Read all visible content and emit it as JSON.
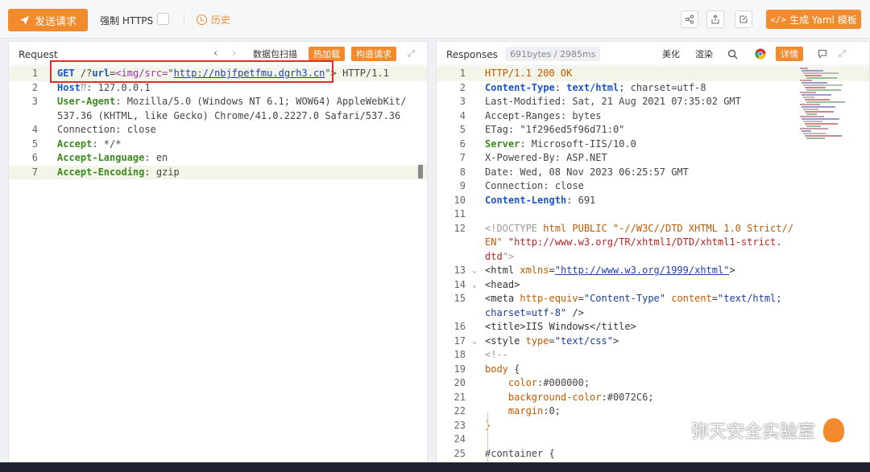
{
  "toolbar": {
    "send_label": "发送请求",
    "https_label": "强制 HTTPS",
    "history_label": "历史",
    "yaml_label": "生成 Yaml 模板",
    "icons": [
      "share-icon",
      "export-icon",
      "edit-icon"
    ]
  },
  "request": {
    "title": "Request",
    "buttons": [
      "数据包扫描",
      "热加载",
      "构造请求"
    ],
    "lines": [
      {
        "n": "1",
        "parts": [
          {
            "t": "GET",
            "c": "kw"
          },
          {
            "t": " /?",
            "c": "val"
          },
          {
            "t": "url",
            "c": "kw"
          },
          {
            "t": "=",
            "c": "val"
          },
          {
            "t": "<img/src=",
            "c": "purple"
          },
          {
            "t": "\"",
            "c": "val"
          },
          {
            "t": "http://nbjfpetfmu.dgrh3.cn",
            "c": "link"
          },
          {
            "t": "\">",
            "c": "val"
          },
          {
            "t": " HTTP/1.1",
            "c": "val"
          }
        ]
      },
      {
        "n": "2",
        "parts": [
          {
            "t": "Host",
            "c": "blu"
          },
          {
            "t": "⁇",
            "c": "gray"
          },
          {
            "t": ": 127.0.0.1",
            "c": "val"
          }
        ]
      },
      {
        "n": "3",
        "parts": [
          {
            "t": "User-Agent",
            "c": "grn"
          },
          {
            "t": ": Mozilla/5.0 (Windows NT 6.1; WOW64) AppleWebKit/",
            "c": "val"
          }
        ]
      },
      {
        "n": "",
        "parts": [
          {
            "t": "537.36 (KHTML, like Gecko) Chrome/41.0.2227.0 Safari/537.36",
            "c": "val"
          }
        ]
      },
      {
        "n": "4",
        "parts": [
          {
            "t": "Connection: close",
            "c": "val"
          }
        ]
      },
      {
        "n": "5",
        "parts": [
          {
            "t": "Accept",
            "c": "grn"
          },
          {
            "t": ": */*",
            "c": "val"
          }
        ]
      },
      {
        "n": "6",
        "parts": [
          {
            "t": "Accept-Language",
            "c": "grn"
          },
          {
            "t": ": en",
            "c": "val"
          }
        ]
      },
      {
        "n": "7",
        "parts": [
          {
            "t": "Accept-Encoding",
            "c": "grn"
          },
          {
            "t": ": gzip",
            "c": "val"
          }
        ]
      }
    ]
  },
  "response": {
    "title": "Responses",
    "size": "691bytes / 2985ms",
    "buttons": [
      "美化",
      "渲染",
      "详情"
    ],
    "lines": [
      {
        "n": "1",
        "f": "",
        "parts": [
          {
            "t": "HTTP/1.1 200 OK",
            "c": "attr"
          }
        ]
      },
      {
        "n": "2",
        "f": "",
        "parts": [
          {
            "t": "Content-Type",
            "c": "blu"
          },
          {
            "t": ": ",
            "c": "val"
          },
          {
            "t": "text/html",
            "c": "kw"
          },
          {
            "t": "; charset=utf-8",
            "c": "val"
          }
        ]
      },
      {
        "n": "3",
        "f": "",
        "parts": [
          {
            "t": "Last-Modified: Sat, 21 Aug 2021 07:35:02 GMT",
            "c": "val"
          }
        ]
      },
      {
        "n": "4",
        "f": "",
        "parts": [
          {
            "t": "Accept-Ranges: bytes",
            "c": "val"
          }
        ]
      },
      {
        "n": "5",
        "f": "",
        "parts": [
          {
            "t": "ETag: \"1f296ed5f96d71:0\"",
            "c": "val"
          }
        ]
      },
      {
        "n": "6",
        "f": "",
        "parts": [
          {
            "t": "Server",
            "c": "grn"
          },
          {
            "t": ": Microsoft-IIS/10.0",
            "c": "val"
          }
        ]
      },
      {
        "n": "7",
        "f": "",
        "parts": [
          {
            "t": "X-Powered-By: ASP.NET",
            "c": "val"
          }
        ]
      },
      {
        "n": "8",
        "f": "",
        "parts": [
          {
            "t": "Date: Wed, 08 Nov 2023 06:25:57 GMT",
            "c": "val"
          }
        ]
      },
      {
        "n": "9",
        "f": "",
        "parts": [
          {
            "t": "Connection: close",
            "c": "val"
          }
        ]
      },
      {
        "n": "10",
        "f": "",
        "parts": [
          {
            "t": "Content-Length",
            "c": "blu"
          },
          {
            "t": ": 691",
            "c": "val"
          }
        ]
      },
      {
        "n": "11",
        "f": "",
        "parts": []
      },
      {
        "n": "12",
        "f": "",
        "parts": [
          {
            "t": "<!DOCTYPE ",
            "c": "gray"
          },
          {
            "t": "html PUBLIC ",
            "c": "attr"
          },
          {
            "t": "\"-//W3C//DTD XHTML 1.0 Strict//",
            "c": "attr"
          }
        ]
      },
      {
        "n": "",
        "f": "",
        "parts": [
          {
            "t": "EN\" ",
            "c": "attr"
          },
          {
            "t": "\"http://www.w3.org/TR/xhtml1/DTD/xhtml1-strict.",
            "c": "redstr"
          }
        ]
      },
      {
        "n": "",
        "f": "",
        "parts": [
          {
            "t": "dtd",
            "c": "redstr"
          },
          {
            "t": "\">",
            "c": "gray"
          }
        ]
      },
      {
        "n": "13",
        "f": "v",
        "parts": [
          {
            "t": "<html ",
            "c": "tag"
          },
          {
            "t": "xmlns",
            "c": "attr"
          },
          {
            "t": "=",
            "c": "val"
          },
          {
            "t": "\"http://www.w3.org/1999/xhtml\"",
            "c": "link"
          },
          {
            "t": ">",
            "c": "tag"
          }
        ]
      },
      {
        "n": "14",
        "f": "v",
        "parts": [
          {
            "t": "<head>",
            "c": "tag"
          }
        ]
      },
      {
        "n": "15",
        "f": "",
        "parts": [
          {
            "t": "<meta ",
            "c": "tag"
          },
          {
            "t": "http-equiv",
            "c": "attr"
          },
          {
            "t": "=",
            "c": "val"
          },
          {
            "t": "\"Content-Type\"",
            "c": "str"
          },
          {
            "t": " content",
            "c": "attr"
          },
          {
            "t": "=",
            "c": "val"
          },
          {
            "t": "\"text/html;",
            "c": "str"
          }
        ]
      },
      {
        "n": "",
        "f": "",
        "parts": [
          {
            "t": "charset=utf-8\"",
            "c": "str"
          },
          {
            "t": " />",
            "c": "tag"
          }
        ]
      },
      {
        "n": "16",
        "f": "",
        "parts": [
          {
            "t": "<title>IIS Windows</title>",
            "c": "tag"
          }
        ]
      },
      {
        "n": "17",
        "f": "v",
        "parts": [
          {
            "t": "<style ",
            "c": "tag"
          },
          {
            "t": "type",
            "c": "attr"
          },
          {
            "t": "=",
            "c": "val"
          },
          {
            "t": "\"text/css\"",
            "c": "str"
          },
          {
            "t": ">",
            "c": "tag"
          }
        ]
      },
      {
        "n": "18",
        "f": "",
        "parts": [
          {
            "t": "<!--",
            "c": "gray"
          }
        ]
      },
      {
        "n": "19",
        "f": "",
        "parts": [
          {
            "t": "body",
            "c": "attr"
          },
          {
            "t": " {",
            "c": "val"
          }
        ]
      },
      {
        "n": "20",
        "f": "",
        "parts": [
          {
            "t": "    color",
            "c": "css-prop"
          },
          {
            "t": ":",
            "c": "val"
          },
          {
            "t": "#000000",
            "c": "val"
          },
          {
            "t": ";",
            "c": "val"
          }
        ]
      },
      {
        "n": "21",
        "f": "",
        "parts": [
          {
            "t": "    background-color",
            "c": "css-prop"
          },
          {
            "t": ":",
            "c": "val"
          },
          {
            "t": "#0072C6",
            "c": "val"
          },
          {
            "t": ";",
            "c": "val"
          }
        ]
      },
      {
        "n": "22",
        "f": "",
        "parts": [
          {
            "t": "    margin",
            "c": "css-prop"
          },
          {
            "t": ":",
            "c": "val"
          },
          {
            "t": "0",
            "c": "val"
          },
          {
            "t": ";",
            "c": "val"
          }
        ]
      },
      {
        "n": "23",
        "f": "",
        "parts": [
          {
            "t": "}",
            "c": "attr"
          }
        ]
      },
      {
        "n": "24",
        "f": "",
        "parts": []
      },
      {
        "n": "25",
        "f": "",
        "parts": [
          {
            "t": "#container {",
            "c": "val"
          }
        ]
      }
    ]
  },
  "watermark": {
    "text": "弥天安全实验室"
  }
}
